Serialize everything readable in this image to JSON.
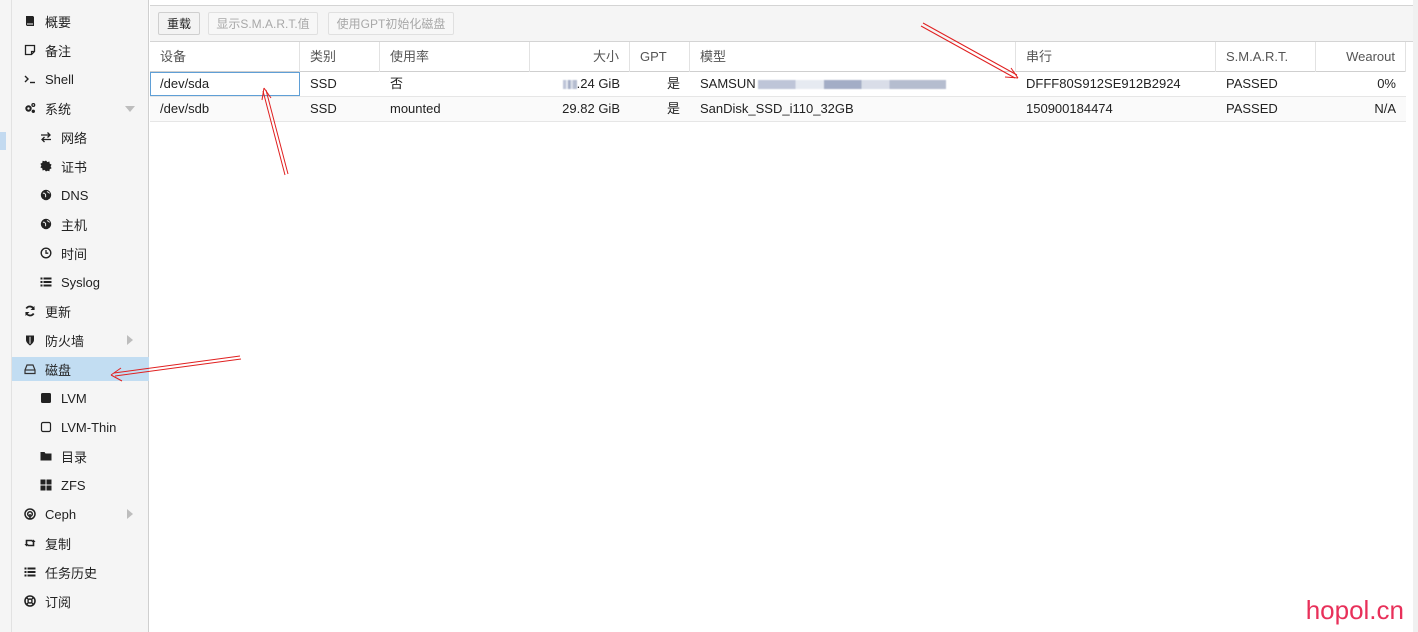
{
  "sidebar": {
    "items": [
      {
        "label": "概要",
        "icon": "book-icon"
      },
      {
        "label": "备注",
        "icon": "note-icon"
      },
      {
        "label": "Shell",
        "icon": "terminal-icon"
      },
      {
        "label": "系统",
        "icon": "cogs-icon"
      },
      {
        "label": "网络",
        "icon": "exchange-icon"
      },
      {
        "label": "证书",
        "icon": "certificate-icon"
      },
      {
        "label": "DNS",
        "icon": "globe-icon"
      },
      {
        "label": "主机",
        "icon": "globe-icon"
      },
      {
        "label": "时间",
        "icon": "clock-icon"
      },
      {
        "label": "Syslog",
        "icon": "list-icon"
      },
      {
        "label": "更新",
        "icon": "refresh-icon"
      },
      {
        "label": "防火墙",
        "icon": "shield-icon"
      },
      {
        "label": "磁盘",
        "icon": "hdd-icon"
      },
      {
        "label": "LVM",
        "icon": "square-icon"
      },
      {
        "label": "LVM-Thin",
        "icon": "square-outline-icon"
      },
      {
        "label": "目录",
        "icon": "folder-icon"
      },
      {
        "label": "ZFS",
        "icon": "grid-icon"
      },
      {
        "label": "Ceph",
        "icon": "ceph-icon"
      },
      {
        "label": "复制",
        "icon": "retweet-icon"
      },
      {
        "label": "任务历史",
        "icon": "list-icon"
      },
      {
        "label": "订阅",
        "icon": "support-icon"
      }
    ],
    "selected": "磁盘"
  },
  "toolbar": {
    "reload_label": "重载",
    "smart_label": "显示S.M.A.R.T.值",
    "gpt_label": "使用GPT初始化磁盘"
  },
  "grid": {
    "columns": [
      "设备",
      "类别",
      "使用率",
      "大小",
      "GPT",
      "模型",
      "串行",
      "S.M.A.R.T.",
      "Wearout"
    ],
    "rows": [
      {
        "device": "/dev/sda",
        "type": "SSD",
        "usage": "否",
        "size": ".24 GiB",
        "gpt": "是",
        "model": "SAMSUN",
        "serial": "DFFF80S912SE912B2924",
        "smart": "PASSED",
        "wearout": "0%"
      },
      {
        "device": "/dev/sdb",
        "type": "SSD",
        "usage": "mounted",
        "size": "29.82 GiB",
        "gpt": "是",
        "model": "SanDisk_SSD_i110_32GB",
        "serial": "150900184474",
        "smart": "PASSED",
        "wearout": "N/A"
      }
    ]
  },
  "watermark": "hopol.cn",
  "colors": {
    "selected_bg": "#c2ddf2",
    "annotation_arrow": "#e02020",
    "watermark": "#e8305a"
  }
}
